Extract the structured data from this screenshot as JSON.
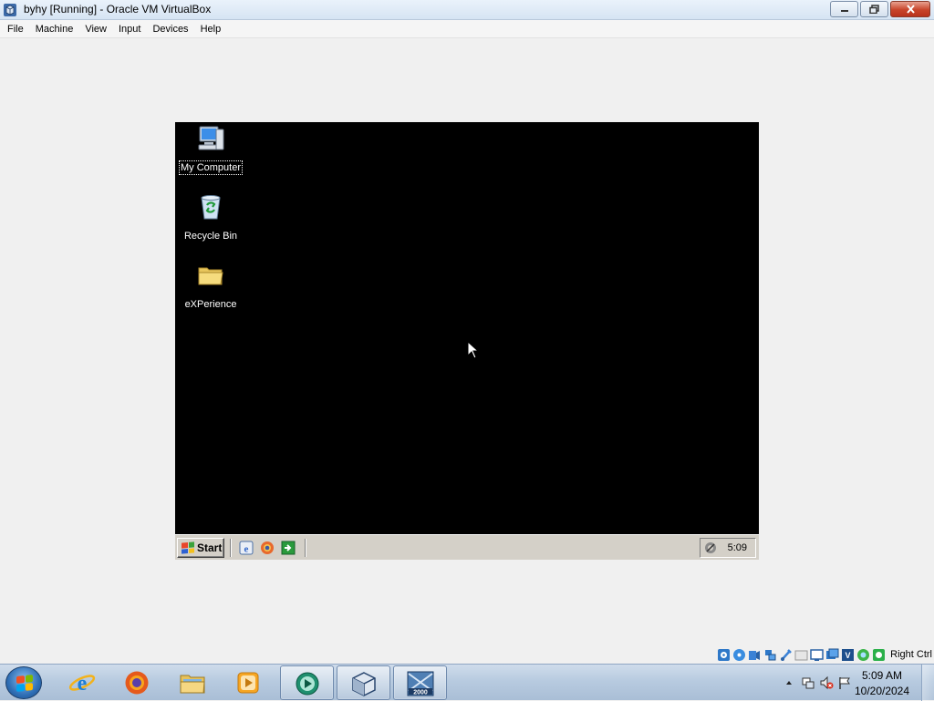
{
  "window": {
    "title": "byhy [Running] - Oracle VM VirtualBox",
    "app_icon": "virtualbox-icon",
    "controls": [
      "minimize",
      "restore",
      "close"
    ]
  },
  "menu": [
    {
      "label": "File"
    },
    {
      "label": "Machine"
    },
    {
      "label": "View"
    },
    {
      "label": "Input"
    },
    {
      "label": "Devices"
    },
    {
      "label": "Help"
    }
  ],
  "guest": {
    "desktop_icons": [
      {
        "label": "My Computer",
        "icon": "my-computer-icon",
        "selected": true
      },
      {
        "label": "Recycle Bin",
        "icon": "recycle-bin-icon",
        "selected": false
      },
      {
        "label": "eXPerience",
        "icon": "folder-icon",
        "selected": false
      }
    ],
    "taskbar": {
      "start_label": "Start",
      "quick_launch": [
        "ie-icon",
        "firefox-icon",
        "show-desktop-icon"
      ],
      "tray_icon": "sound-icon",
      "clock": "5:09"
    }
  },
  "vbox_status": {
    "icons": [
      "hard-disk-icon",
      "optical-drive-icon",
      "audio-icon",
      "network-icon",
      "usb-icon",
      "shared-folders-icon",
      "display-icon",
      "video-capture-icon",
      "processor-icon",
      "mouse-integration-icon",
      "guest-additions-icon"
    ],
    "host_key": "Right Ctrl"
  },
  "host_taskbar": {
    "pinned": [
      {
        "name": "internet-explorer-icon",
        "active": false
      },
      {
        "name": "firefox-icon",
        "active": false
      },
      {
        "name": "windows-explorer-icon",
        "active": false
      },
      {
        "name": "media-player-icon",
        "active": false
      },
      {
        "name": "teal-circle-app-icon",
        "active": true
      },
      {
        "name": "virtualbox-icon",
        "active": true
      },
      {
        "name": "windows-2000-vm-icon",
        "active": true
      }
    ],
    "vm_icon_badge": "2000",
    "clock_time": "5:09 AM",
    "clock_date": "10/20/2024"
  },
  "colors": {
    "guest_background": "#000000",
    "guest_taskbar": "#d4d0c8",
    "host_taskbar": "#b8cbe0"
  }
}
